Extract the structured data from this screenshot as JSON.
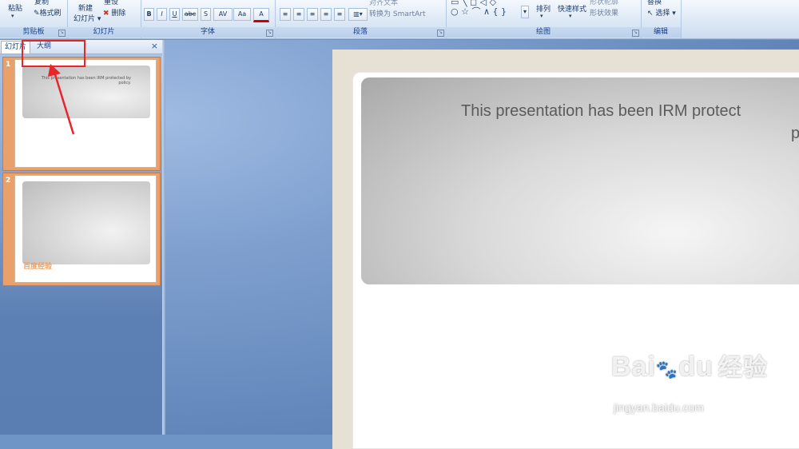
{
  "ribbon": {
    "clipboard": {
      "label": "剪贴板",
      "paste": "粘贴",
      "copy": "复制",
      "format_painter": "格式刷"
    },
    "slides": {
      "label": "幻灯片",
      "new_slide_line1": "新建",
      "new_slide_line2": "幻灯片",
      "reset": "重设",
      "delete": "删除"
    },
    "font": {
      "label": "字体",
      "bold": "B",
      "italic": "I",
      "underline": "U",
      "strike": "abc",
      "shadow": "S",
      "spacing": "AV",
      "case": "Aa",
      "color": "A"
    },
    "paragraph": {
      "label": "段落",
      "align_text": "对齐文本",
      "convert_smartart": "转换为 SmartArt"
    },
    "drawing": {
      "label": "绘图",
      "arrange": "排列",
      "quick_styles": "快速样式",
      "shape_outline": "形状轮廓",
      "shape_effects": "形状效果"
    },
    "editing": {
      "label": "编辑",
      "replace": "替换",
      "select": "选择"
    }
  },
  "pane": {
    "tab_slides": "幻灯片",
    "tab_outline": "大纲",
    "close": "×",
    "thumbs": [
      {
        "num": "1",
        "title": "This presentation has been IRM protected by policy."
      },
      {
        "num": "2",
        "watermark": "百度经验"
      }
    ]
  },
  "slide": {
    "title_line1": "This presentation has been IRM protect",
    "title_line2": "p"
  },
  "watermark": {
    "brand": "Bai",
    "brand2": "du",
    "cn": "经验",
    "url": "jingyan.baidu.com"
  },
  "colors": {
    "highlight": "#e8262a",
    "ribbon_text": "#15428b"
  }
}
